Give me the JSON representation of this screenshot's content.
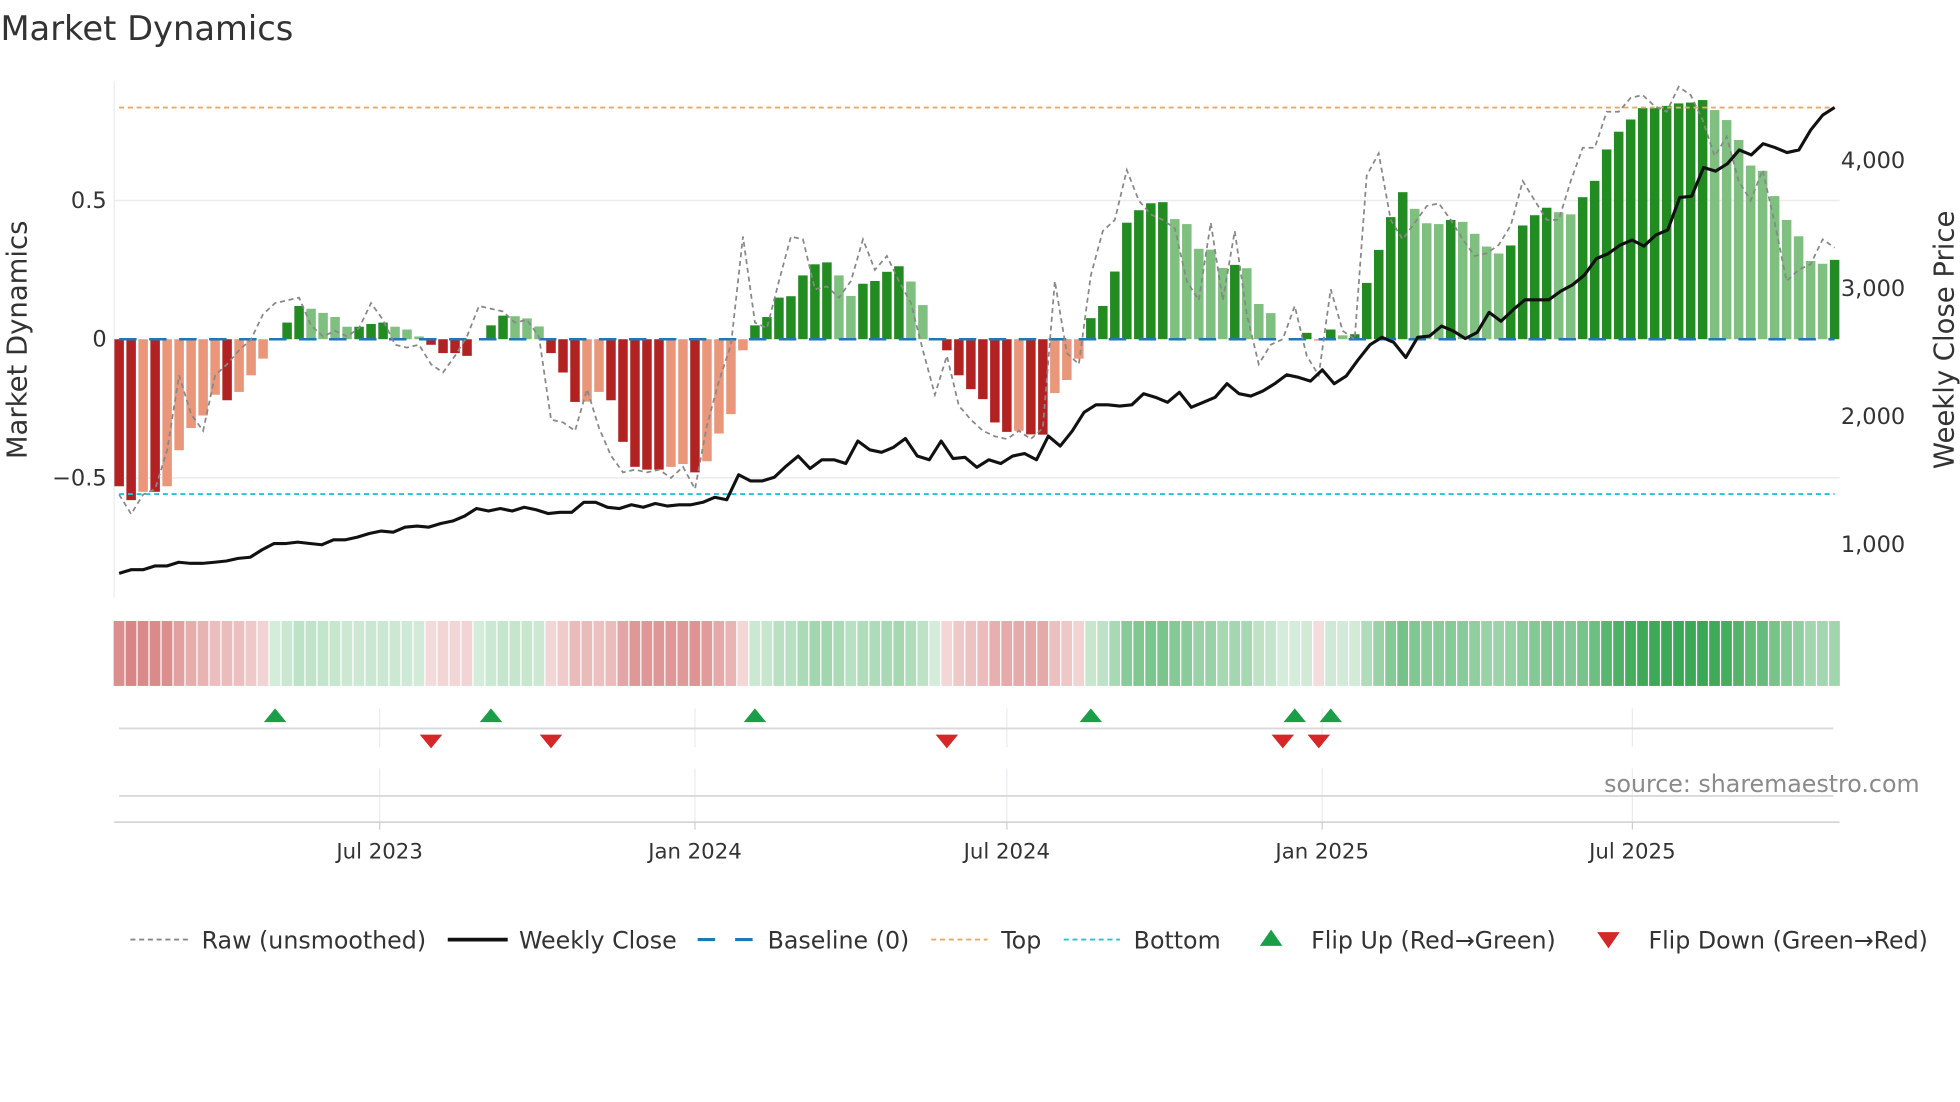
{
  "title": "Market Dynamics",
  "source": "source: sharemaestro.com",
  "colors": {
    "bar_neg_strong": "#b22222",
    "bar_neg_weak": "#e9967a",
    "bar_pos_strong": "#228b22",
    "bar_pos_weak": "#7fbf7f",
    "raw": "#888888",
    "close": "#111111",
    "baseline": "#1f77b4",
    "top": "#e8a866",
    "bottom": "#22c5d8",
    "flip_up": "#1a9e48",
    "flip_down": "#d62728"
  },
  "chart_data": {
    "type": "bar",
    "title": "Market Dynamics",
    "ylabel": "Market Dynamics",
    "y2label": "Weekly Close Price",
    "ylim": [
      -0.93,
      0.93
    ],
    "y2lim": [
      590,
      4620
    ],
    "yticks": [
      {
        "v": 0.5,
        "label": "0.5"
      },
      {
        "v": 0,
        "label": "0"
      },
      {
        "v": -0.5,
        "label": "−0.5"
      }
    ],
    "y2ticks": [
      {
        "v": 4000,
        "label": "4,000"
      },
      {
        "v": 3000,
        "label": "3,000"
      },
      {
        "v": 2000,
        "label": "2,000"
      },
      {
        "v": 1000,
        "label": "1,000"
      }
    ],
    "x_start": "2023-01-30",
    "x_step_days": 7,
    "xticks": [
      {
        "date": "2023-07-01",
        "label": "Jul 2023"
      },
      {
        "date": "2024-01-01",
        "label": "Jan 2024"
      },
      {
        "date": "2024-07-01",
        "label": "Jul 2024"
      },
      {
        "date": "2025-01-01",
        "label": "Jan 2025"
      },
      {
        "date": "2025-07-01",
        "label": "Jul 2025"
      }
    ],
    "top_level": 0.835,
    "bottom_level": -0.558,
    "baseline": 0,
    "smoothed": [
      -0.53,
      -0.58,
      -0.55,
      -0.55,
      -0.53,
      -0.4,
      -0.32,
      -0.275,
      -0.2,
      -0.22,
      -0.19,
      -0.13,
      -0.07,
      0,
      0.06,
      0.12,
      0.11,
      0.095,
      0.08,
      0.045,
      0.045,
      0.055,
      0.06,
      0.045,
      0.035,
      0.01,
      -0.02,
      -0.05,
      -0.05,
      -0.06,
      0,
      0.05,
      0.085,
      0.083,
      0.075,
      0.046,
      -0.05,
      -0.12,
      -0.226,
      -0.225,
      -0.19,
      -0.22,
      -0.37,
      -0.46,
      -0.47,
      -0.47,
      -0.46,
      -0.45,
      -0.48,
      -0.44,
      -0.34,
      -0.27,
      -0.04,
      0.05,
      0.08,
      0.15,
      0.155,
      0.23,
      0.27,
      0.277,
      0.23,
      0.156,
      0.2,
      0.21,
      0.243,
      0.263,
      0.208,
      0.123,
      0,
      -0.04,
      -0.13,
      -0.18,
      -0.216,
      -0.3,
      -0.334,
      -0.33,
      -0.343,
      -0.344,
      -0.194,
      -0.147,
      -0.07,
      0.076,
      0.12,
      0.244,
      0.42,
      0.465,
      0.49,
      0.494,
      0.433,
      0.415,
      0.326,
      0.323,
      0.257,
      0.268,
      0.256,
      0.127,
      0.094,
      0,
      0,
      0.023,
      -0.005,
      0.035,
      0.014,
      0.018,
      0.203,
      0.322,
      0.44,
      0.53,
      0.47,
      0.418,
      0.415,
      0.43,
      0.423,
      0.38,
      0.334,
      0.309,
      0.338,
      0.41,
      0.447,
      0.474,
      0.458,
      0.45,
      0.512,
      0.571,
      0.684,
      0.748,
      0.792,
      0.833,
      0.833,
      0.841,
      0.85,
      0.853,
      0.862,
      0.826,
      0.79,
      0.718,
      0.626,
      0.607,
      0.516,
      0.43,
      0.371,
      0.282,
      0.272,
      0.286
    ],
    "raw": [
      -0.56,
      -0.63,
      -0.56,
      -0.54,
      -0.4,
      -0.13,
      -0.27,
      -0.33,
      -0.13,
      -0.09,
      -0.04,
      0.0,
      0.09,
      0.13,
      0.14,
      0.15,
      0.05,
      0.01,
      0.03,
      0.01,
      0.04,
      0.13,
      0.07,
      -0.02,
      -0.03,
      -0.02,
      -0.09,
      -0.12,
      -0.06,
      0.01,
      0.12,
      0.11,
      0.1,
      0.06,
      0.07,
      0.01,
      -0.29,
      -0.3,
      -0.33,
      -0.18,
      -0.32,
      -0.42,
      -0.48,
      -0.47,
      -0.48,
      -0.47,
      -0.5,
      -0.46,
      -0.54,
      -0.31,
      -0.15,
      -0.02,
      0.37,
      0.06,
      0.04,
      0.21,
      0.37,
      0.36,
      0.18,
      0.19,
      0.15,
      0.21,
      0.36,
      0.25,
      0.3,
      0.21,
      0.13,
      -0.04,
      -0.2,
      -0.06,
      -0.24,
      -0.29,
      -0.33,
      -0.35,
      -0.36,
      -0.33,
      -0.36,
      -0.32,
      0.21,
      -0.05,
      -0.09,
      0.23,
      0.39,
      0.43,
      0.61,
      0.5,
      0.45,
      0.43,
      0.4,
      0.21,
      0.14,
      0.42,
      0.14,
      0.39,
      0.09,
      -0.09,
      -0.02,
      0.0,
      0.12,
      -0.06,
      -0.13,
      0.18,
      0.03,
      0.0,
      0.59,
      0.67,
      0.43,
      0.36,
      0.42,
      0.48,
      0.49,
      0.43,
      0.36,
      0.3,
      0.31,
      0.34,
      0.41,
      0.57,
      0.5,
      0.43,
      0.43,
      0.57,
      0.69,
      0.69,
      0.82,
      0.82,
      0.87,
      0.88,
      0.84,
      0.82,
      0.91,
      0.88,
      0.79,
      0.66,
      0.73,
      0.57,
      0.5,
      0.61,
      0.42,
      0.21,
      0.25,
      0.27,
      0.36,
      0.33
    ],
    "weekly_close": [
      776,
      805,
      805,
      834,
      834,
      863,
      854,
      854,
      863,
      873,
      893,
      902,
      961,
      1010,
      1010,
      1020,
      1010,
      1000,
      1039,
      1039,
      1059,
      1088,
      1107,
      1098,
      1137,
      1146,
      1137,
      1166,
      1185,
      1224,
      1283,
      1263,
      1283,
      1263,
      1293,
      1273,
      1244,
      1254,
      1254,
      1332,
      1332,
      1293,
      1283,
      1312,
      1293,
      1322,
      1302,
      1312,
      1312,
      1332,
      1371,
      1351,
      1546,
      1498,
      1498,
      1527,
      1615,
      1693,
      1595,
      1663,
      1663,
      1634,
      1810,
      1741,
      1722,
      1761,
      1829,
      1693,
      1663,
      1810,
      1673,
      1683,
      1605,
      1663,
      1634,
      1693,
      1712,
      1663,
      1849,
      1771,
      1888,
      2034,
      2093,
      2093,
      2083,
      2093,
      2180,
      2151,
      2112,
      2190,
      2073,
      2112,
      2151,
      2258,
      2180,
      2161,
      2200,
      2258,
      2327,
      2307,
      2278,
      2366,
      2258,
      2317,
      2444,
      2561,
      2620,
      2580,
      2463,
      2620,
      2629,
      2707,
      2668,
      2610,
      2659,
      2815,
      2746,
      2834,
      2912,
      2912,
      2912,
      2980,
      3029,
      3107,
      3234,
      3273,
      3341,
      3380,
      3332,
      3420,
      3459,
      3712,
      3722,
      3946,
      3917,
      3976,
      4083,
      4044,
      4132,
      4102,
      4063,
      4083,
      4239,
      4356,
      4415
    ],
    "flip_up_weeks": [
      13,
      31,
      53,
      81,
      98,
      101
    ],
    "flip_down_weeks": [
      26,
      36,
      69,
      97,
      100
    ],
    "legend": {
      "placement": "bottom",
      "items": [
        {
          "key": "raw",
          "label": "Raw (unsmoothed)"
        },
        {
          "key": "close",
          "label": "Weekly Close"
        },
        {
          "key": "baseline",
          "label": "Baseline (0)"
        },
        {
          "key": "top",
          "label": "Top"
        },
        {
          "key": "bottom",
          "label": "Bottom"
        },
        {
          "key": "flip_up",
          "label": "Flip Up (Red→Green)"
        },
        {
          "key": "flip_down",
          "label": "Flip Down (Green→Red)"
        }
      ]
    }
  }
}
